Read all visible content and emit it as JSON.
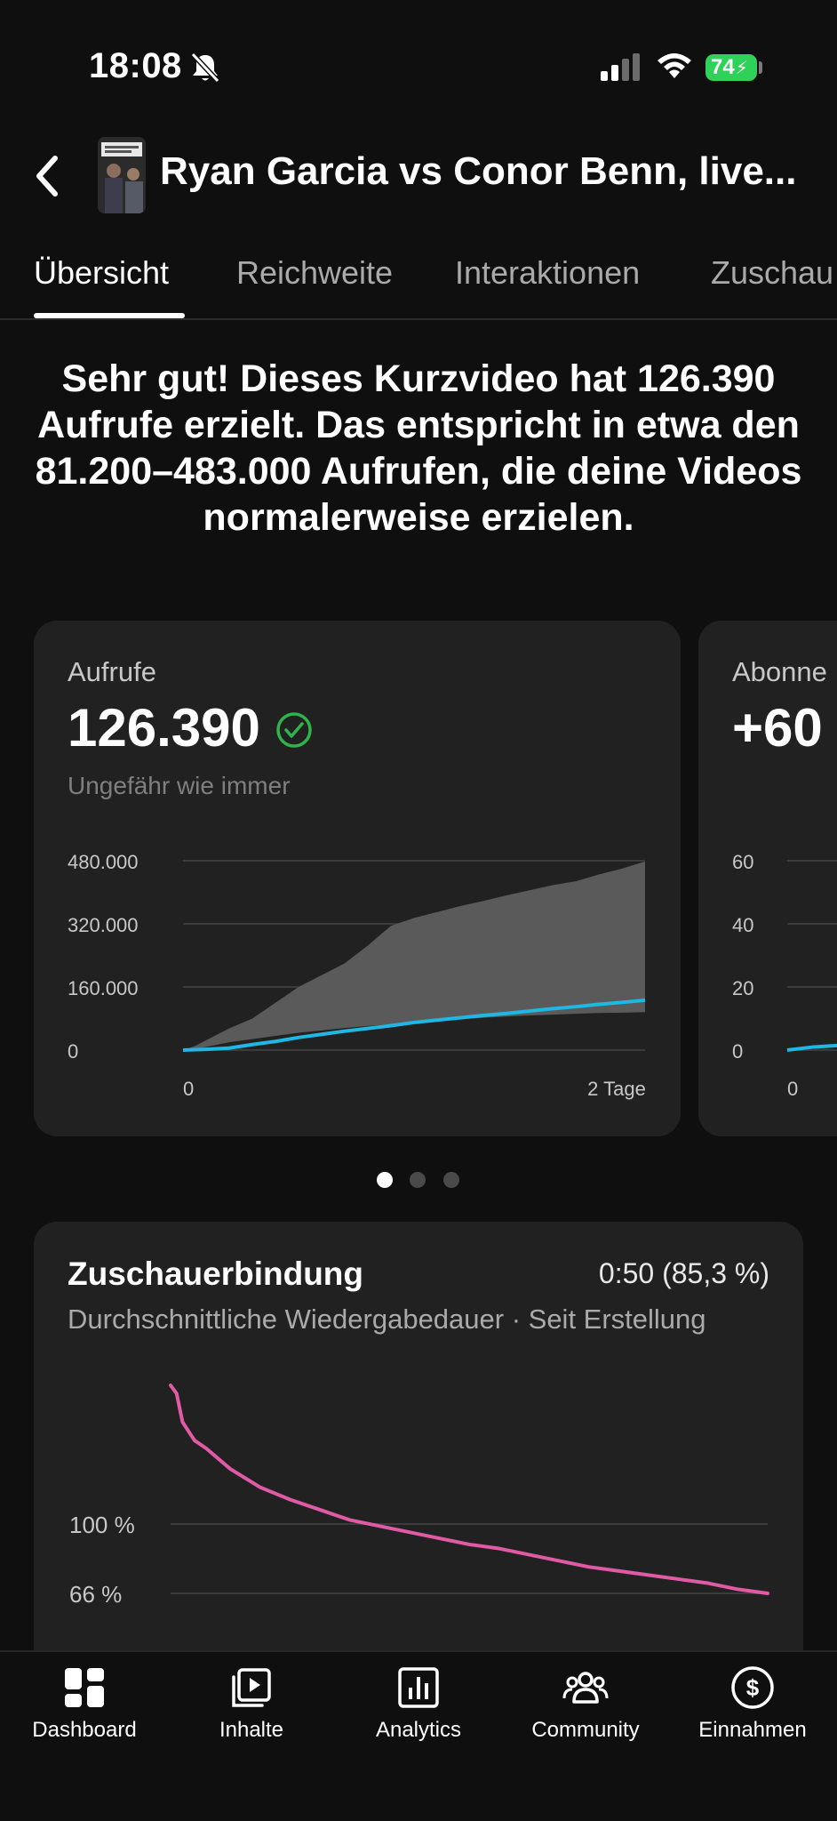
{
  "status_bar": {
    "time": "18:08",
    "battery": "74"
  },
  "header": {
    "title": "Ryan Garcia vs Conor Benn, live..."
  },
  "tabs": [
    {
      "label": "Übersicht",
      "active": true
    },
    {
      "label": "Reichweite",
      "active": false
    },
    {
      "label": "Interaktionen",
      "active": false
    },
    {
      "label": "Zuschau",
      "active": false
    }
  ],
  "headline": "Sehr gut! Dieses Kurzvideo hat 126.390 Aufrufe erzielt. Das entspricht in etwa den 81.200–483.000 Aufrufen, die deine Videos normalerweise erzielen.",
  "cards": [
    {
      "label": "Aufrufe",
      "value": "126.390",
      "status_icon": "check-circle-icon",
      "subtitle": "Ungefähr wie immer"
    },
    {
      "label": "Abonne",
      "value": "+60"
    }
  ],
  "pagination": {
    "pages": 3,
    "current": 1
  },
  "retention": {
    "title": "Zuschauerbindung",
    "value": "0:50 (85,3 %)",
    "subtitle": "Durchschnittliche Wiedergabedauer · Seit Erstellung"
  },
  "bottom_nav": [
    {
      "label": "Dashboard",
      "icon": "dashboard-icon"
    },
    {
      "label": "Inhalte",
      "icon": "content-icon"
    },
    {
      "label": "Analytics",
      "icon": "analytics-icon"
    },
    {
      "label": "Community",
      "icon": "community-icon"
    },
    {
      "label": "Einnahmen",
      "icon": "earnings-icon"
    }
  ],
  "colors": {
    "views_line": "#1fb7e3",
    "typical_range": "#5a5a5a",
    "retention_line": "#e05aa6",
    "check": "#2fb34a"
  },
  "chart_data": [
    {
      "type": "area",
      "title": "Aufrufe",
      "x_ticks": [
        "0",
        "2 Tage"
      ],
      "y_ticks": [
        "480.000",
        "320.000",
        "160.000",
        "0"
      ],
      "ylim": [
        0,
        480000
      ],
      "xlim": [
        0,
        2
      ],
      "grid": true,
      "series": [
        {
          "role": "typical_range",
          "x": [
            0,
            0.05,
            0.1,
            0.15,
            0.2,
            0.3,
            0.4,
            0.5,
            0.6,
            0.7,
            0.8,
            0.9,
            1.0,
            1.1,
            1.2,
            1.3,
            1.4,
            1.5,
            1.6,
            1.7,
            1.8,
            1.9,
            2.0
          ],
          "lower": [
            0,
            3000,
            8000,
            14000,
            20000,
            28000,
            36000,
            44000,
            50000,
            56000,
            61000,
            66000,
            70000,
            74000,
            78000,
            82000,
            85000,
            88000,
            90000,
            92000,
            94000,
            95000,
            96000
          ],
          "upper": [
            0,
            10000,
            25000,
            40000,
            55000,
            80000,
            120000,
            160000,
            190000,
            220000,
            265000,
            315000,
            335000,
            350000,
            365000,
            378000,
            392000,
            405000,
            418000,
            428000,
            445000,
            460000,
            478000
          ]
        },
        {
          "role": "this_video",
          "x": [
            0,
            0.1,
            0.2,
            0.3,
            0.4,
            0.5,
            0.6,
            0.7,
            0.8,
            0.9,
            1.0,
            1.1,
            1.2,
            1.3,
            1.4,
            1.5,
            1.6,
            1.7,
            1.8,
            1.9,
            2.0
          ],
          "y": [
            0,
            2000,
            5000,
            14000,
            22000,
            32000,
            40000,
            48000,
            55000,
            62000,
            70000,
            76000,
            82000,
            88000,
            93000,
            99000,
            105000,
            110000,
            116000,
            121000,
            126390
          ]
        }
      ]
    },
    {
      "type": "line",
      "title": "Abonne",
      "x_ticks": [
        "0"
      ],
      "y_ticks": [
        "60",
        "40",
        "20",
        "0"
      ],
      "ylim": [
        0,
        60
      ],
      "grid": true,
      "series": [
        {
          "role": "this_video",
          "x": [
            0,
            0.1,
            0.2,
            0.3
          ],
          "y": [
            0,
            1,
            1.5,
            2
          ]
        }
      ]
    },
    {
      "type": "line",
      "title": "Zuschauerbindung",
      "y_ticks": [
        "100 %",
        "66 %"
      ],
      "grid": true,
      "series": [
        {
          "role": "retention",
          "x": [
            0,
            0.01,
            0.02,
            0.04,
            0.06,
            0.1,
            0.15,
            0.2,
            0.25,
            0.3,
            0.35,
            0.4,
            0.45,
            0.5,
            0.55,
            0.6,
            0.65,
            0.7,
            0.75,
            0.8,
            0.85,
            0.9,
            0.95,
            1.0
          ],
          "y": [
            168,
            164,
            150,
            141,
            137,
            127,
            118,
            112,
            107,
            102,
            99,
            96,
            93,
            90,
            88,
            85,
            82,
            79,
            77,
            75,
            73,
            71,
            68,
            66
          ]
        }
      ]
    }
  ]
}
